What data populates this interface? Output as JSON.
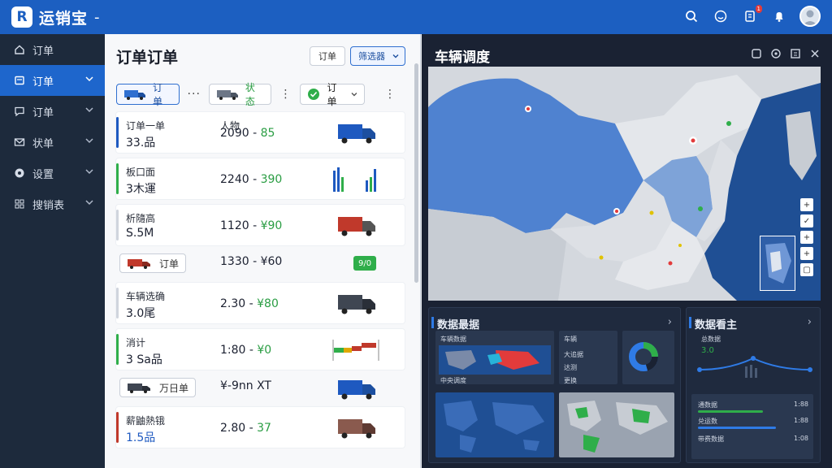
{
  "app": {
    "title": "运销宝",
    "title_suffix": "-"
  },
  "topbar": {
    "notification_count": "1"
  },
  "sidebar": {
    "items": [
      {
        "label": "订单",
        "icon": "home-icon",
        "active": false,
        "chevron": false
      },
      {
        "label": "订单",
        "icon": "order-icon",
        "active": true,
        "chevron": true
      },
      {
        "label": "订单",
        "icon": "chat-icon",
        "active": false,
        "chevron": true
      },
      {
        "label": "状单",
        "icon": "mail-icon",
        "active": false,
        "chevron": true
      },
      {
        "label": "设置",
        "icon": "settings-icon",
        "active": false,
        "chevron": true
      },
      {
        "label": "搜销表",
        "icon": "grid-icon",
        "active": false,
        "chevron": true
      }
    ]
  },
  "orders": {
    "title": "订单订单",
    "order_button": "订单",
    "filter_button": "筛选器",
    "tabs": [
      {
        "label": "订单",
        "icon": "truck-icon"
      },
      {
        "label": "状态",
        "icon": "truck-icon"
      },
      {
        "label": "订单",
        "icon": "check-circle-icon"
      }
    ],
    "rows": [
      {
        "type": "item",
        "name": "订单一单",
        "sub": "33.品",
        "mid": "人物",
        "price": "2090 - ",
        "price_hl": "85",
        "accent": "#1e59c0",
        "visual": "truck-blue"
      },
      {
        "type": "item",
        "name": "板口面",
        "sub": "3木運",
        "mid": "",
        "price": "2240 - ",
        "price_hl": "390",
        "accent": "#2fae4a",
        "visual": "bars"
      },
      {
        "type": "item",
        "name": "析隨高",
        "sub": "S.5M",
        "mid": "",
        "price": "1120 - ",
        "price_hl": "¥90",
        "accent": "#d0d5dd",
        "visual": "truck-red"
      },
      {
        "type": "group",
        "chip": "订单",
        "price": "1330 - ",
        "price_hl": "¥60",
        "badge": "9/0"
      },
      {
        "type": "item",
        "name": "车辆选确",
        "sub": "3.0尾",
        "mid": "",
        "price": "2.30 - ",
        "price_hl": "¥80",
        "accent": "#d0d5dd",
        "visual": "truck-gray"
      },
      {
        "type": "item",
        "name": "消计",
        "sub": "3 Sa品",
        "mid": "",
        "price": "1:80 - ",
        "price_hl": "¥0",
        "accent": "#2fae4a",
        "visual": "flags"
      },
      {
        "type": "group",
        "chip": "万日单",
        "price": "¥-9nn XT",
        "price_hl": "",
        "badge": "",
        "visual": "truck-blue"
      },
      {
        "type": "item",
        "name": "薪鼬熱锇",
        "sub": "1.5品",
        "mid": "",
        "price": "2.80 - ",
        "price_hl": "37",
        "accent": "#c0392b",
        "visual": "truck-brown",
        "sub_blue": true
      }
    ]
  },
  "dispatch": {
    "title": "车辆调度",
    "cards": {
      "data_left": {
        "title": "数据最据",
        "mini1": "车辆数据",
        "mini2": "车辆",
        "mini3": "大追据",
        "mini4": "达测",
        "mini5": "更换",
        "mini6": "中央调度"
      },
      "data_right": {
        "title": "数据看主",
        "top_label": "总数据",
        "value": "3.0",
        "items": [
          {
            "label": "通数据",
            "value": "1:88"
          },
          {
            "label": "兑运数",
            "value": "1:88"
          },
          {
            "label": "带费数据",
            "value": "1:08"
          }
        ]
      }
    }
  },
  "colors": {
    "brand": "#1c5fc1",
    "accent_green": "#2fae4a",
    "dark_panel": "#1a2233"
  }
}
